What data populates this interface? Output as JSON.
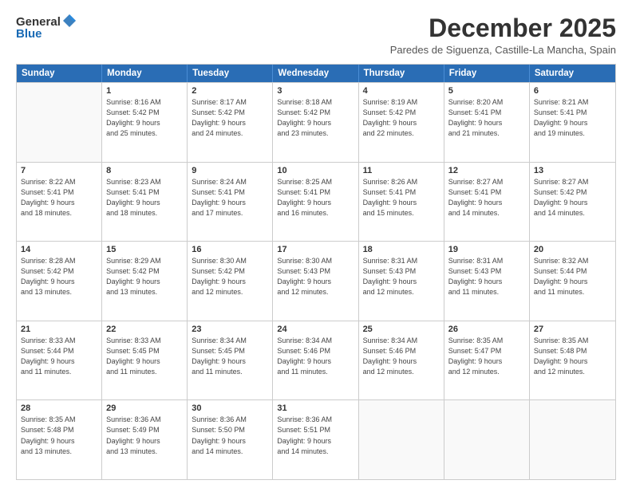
{
  "logo": {
    "general": "General",
    "blue": "Blue"
  },
  "header": {
    "month_title": "December 2025",
    "location": "Paredes de Siguenza, Castille-La Mancha, Spain"
  },
  "weekdays": [
    "Sunday",
    "Monday",
    "Tuesday",
    "Wednesday",
    "Thursday",
    "Friday",
    "Saturday"
  ],
  "weeks": [
    [
      {
        "day": "",
        "info": ""
      },
      {
        "day": "1",
        "info": "Sunrise: 8:16 AM\nSunset: 5:42 PM\nDaylight: 9 hours\nand 25 minutes."
      },
      {
        "day": "2",
        "info": "Sunrise: 8:17 AM\nSunset: 5:42 PM\nDaylight: 9 hours\nand 24 minutes."
      },
      {
        "day": "3",
        "info": "Sunrise: 8:18 AM\nSunset: 5:42 PM\nDaylight: 9 hours\nand 23 minutes."
      },
      {
        "day": "4",
        "info": "Sunrise: 8:19 AM\nSunset: 5:42 PM\nDaylight: 9 hours\nand 22 minutes."
      },
      {
        "day": "5",
        "info": "Sunrise: 8:20 AM\nSunset: 5:41 PM\nDaylight: 9 hours\nand 21 minutes."
      },
      {
        "day": "6",
        "info": "Sunrise: 8:21 AM\nSunset: 5:41 PM\nDaylight: 9 hours\nand 19 minutes."
      }
    ],
    [
      {
        "day": "7",
        "info": "Sunrise: 8:22 AM\nSunset: 5:41 PM\nDaylight: 9 hours\nand 18 minutes."
      },
      {
        "day": "8",
        "info": "Sunrise: 8:23 AM\nSunset: 5:41 PM\nDaylight: 9 hours\nand 18 minutes."
      },
      {
        "day": "9",
        "info": "Sunrise: 8:24 AM\nSunset: 5:41 PM\nDaylight: 9 hours\nand 17 minutes."
      },
      {
        "day": "10",
        "info": "Sunrise: 8:25 AM\nSunset: 5:41 PM\nDaylight: 9 hours\nand 16 minutes."
      },
      {
        "day": "11",
        "info": "Sunrise: 8:26 AM\nSunset: 5:41 PM\nDaylight: 9 hours\nand 15 minutes."
      },
      {
        "day": "12",
        "info": "Sunrise: 8:27 AM\nSunset: 5:41 PM\nDaylight: 9 hours\nand 14 minutes."
      },
      {
        "day": "13",
        "info": "Sunrise: 8:27 AM\nSunset: 5:42 PM\nDaylight: 9 hours\nand 14 minutes."
      }
    ],
    [
      {
        "day": "14",
        "info": "Sunrise: 8:28 AM\nSunset: 5:42 PM\nDaylight: 9 hours\nand 13 minutes."
      },
      {
        "day": "15",
        "info": "Sunrise: 8:29 AM\nSunset: 5:42 PM\nDaylight: 9 hours\nand 13 minutes."
      },
      {
        "day": "16",
        "info": "Sunrise: 8:30 AM\nSunset: 5:42 PM\nDaylight: 9 hours\nand 12 minutes."
      },
      {
        "day": "17",
        "info": "Sunrise: 8:30 AM\nSunset: 5:43 PM\nDaylight: 9 hours\nand 12 minutes."
      },
      {
        "day": "18",
        "info": "Sunrise: 8:31 AM\nSunset: 5:43 PM\nDaylight: 9 hours\nand 12 minutes."
      },
      {
        "day": "19",
        "info": "Sunrise: 8:31 AM\nSunset: 5:43 PM\nDaylight: 9 hours\nand 11 minutes."
      },
      {
        "day": "20",
        "info": "Sunrise: 8:32 AM\nSunset: 5:44 PM\nDaylight: 9 hours\nand 11 minutes."
      }
    ],
    [
      {
        "day": "21",
        "info": "Sunrise: 8:33 AM\nSunset: 5:44 PM\nDaylight: 9 hours\nand 11 minutes."
      },
      {
        "day": "22",
        "info": "Sunrise: 8:33 AM\nSunset: 5:45 PM\nDaylight: 9 hours\nand 11 minutes."
      },
      {
        "day": "23",
        "info": "Sunrise: 8:34 AM\nSunset: 5:45 PM\nDaylight: 9 hours\nand 11 minutes."
      },
      {
        "day": "24",
        "info": "Sunrise: 8:34 AM\nSunset: 5:46 PM\nDaylight: 9 hours\nand 11 minutes."
      },
      {
        "day": "25",
        "info": "Sunrise: 8:34 AM\nSunset: 5:46 PM\nDaylight: 9 hours\nand 12 minutes."
      },
      {
        "day": "26",
        "info": "Sunrise: 8:35 AM\nSunset: 5:47 PM\nDaylight: 9 hours\nand 12 minutes."
      },
      {
        "day": "27",
        "info": "Sunrise: 8:35 AM\nSunset: 5:48 PM\nDaylight: 9 hours\nand 12 minutes."
      }
    ],
    [
      {
        "day": "28",
        "info": "Sunrise: 8:35 AM\nSunset: 5:48 PM\nDaylight: 9 hours\nand 13 minutes."
      },
      {
        "day": "29",
        "info": "Sunrise: 8:36 AM\nSunset: 5:49 PM\nDaylight: 9 hours\nand 13 minutes."
      },
      {
        "day": "30",
        "info": "Sunrise: 8:36 AM\nSunset: 5:50 PM\nDaylight: 9 hours\nand 14 minutes."
      },
      {
        "day": "31",
        "info": "Sunrise: 8:36 AM\nSunset: 5:51 PM\nDaylight: 9 hours\nand 14 minutes."
      },
      {
        "day": "",
        "info": ""
      },
      {
        "day": "",
        "info": ""
      },
      {
        "day": "",
        "info": ""
      }
    ]
  ]
}
